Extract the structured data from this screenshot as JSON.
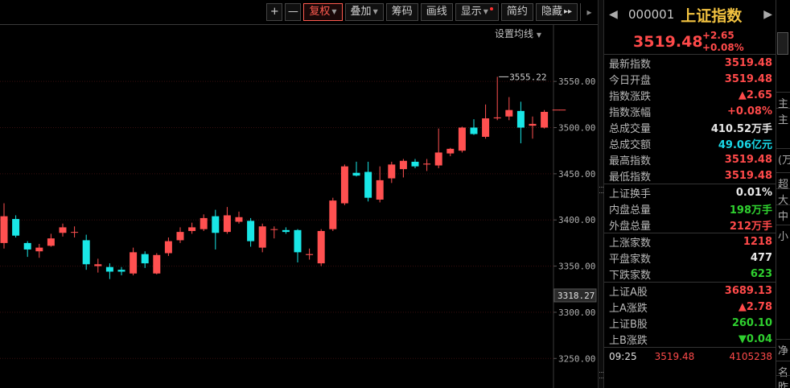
{
  "toolbar": {
    "zoom_in": "+",
    "zoom_out": "—",
    "fq_label": "复权",
    "overlay_label": "叠加",
    "chip_label": "筹码",
    "draw_label": "画线",
    "display_label": "显示",
    "simple_label": "简约",
    "hide_label": "隐藏",
    "more_label": "▸▸"
  },
  "ma_setting_label": "设置均线",
  "colors": {
    "up": "#ff5050",
    "down": "#19e6e6",
    "grid": "#3b0f0f",
    "axis_text": "#b0b0b0"
  },
  "chart_data": {
    "type": "candlestick",
    "y_ticks": [
      "3550.00",
      "3500.00",
      "3450.00",
      "3400.00",
      "3350.00",
      "3300.00",
      "3250.00"
    ],
    "ylim": [
      3218,
      3612
    ],
    "current_price_label": "3318.27",
    "high_annotation": "3555.22",
    "candles": [
      {
        "o": 3375,
        "c": 3404,
        "h": 3418,
        "l": 3369
      },
      {
        "o": 3401,
        "c": 3383,
        "h": 3405,
        "l": 3381
      },
      {
        "o": 3375,
        "c": 3368,
        "h": 3377,
        "l": 3360
      },
      {
        "o": 3366,
        "c": 3370,
        "h": 3374,
        "l": 3359
      },
      {
        "o": 3372,
        "c": 3380,
        "h": 3385,
        "l": 3371
      },
      {
        "o": 3386,
        "c": 3392,
        "h": 3396,
        "l": 3382
      },
      {
        "o": 3387,
        "c": 3387,
        "h": 3393,
        "l": 3381
      },
      {
        "o": 3378,
        "c": 3352,
        "h": 3384,
        "l": 3346
      },
      {
        "o": 3350,
        "c": 3352,
        "h": 3358,
        "l": 3343
      },
      {
        "o": 3349,
        "c": 3344,
        "h": 3353,
        "l": 3336
      },
      {
        "o": 3346,
        "c": 3344,
        "h": 3349,
        "l": 3340
      },
      {
        "o": 3342,
        "c": 3365,
        "h": 3370,
        "l": 3340
      },
      {
        "o": 3363,
        "c": 3353,
        "h": 3366,
        "l": 3348
      },
      {
        "o": 3342,
        "c": 3362,
        "h": 3364,
        "l": 3341
      },
      {
        "o": 3364,
        "c": 3377,
        "h": 3381,
        "l": 3361
      },
      {
        "o": 3378,
        "c": 3387,
        "h": 3392,
        "l": 3375
      },
      {
        "o": 3388,
        "c": 3392,
        "h": 3397,
        "l": 3385
      },
      {
        "o": 3390,
        "c": 3402,
        "h": 3406,
        "l": 3388
      },
      {
        "o": 3404,
        "c": 3386,
        "h": 3411,
        "l": 3368
      },
      {
        "o": 3387,
        "c": 3405,
        "h": 3414,
        "l": 3385
      },
      {
        "o": 3398,
        "c": 3403,
        "h": 3409,
        "l": 3396
      },
      {
        "o": 3399,
        "c": 3377,
        "h": 3402,
        "l": 3371
      },
      {
        "o": 3370,
        "c": 3393,
        "h": 3396,
        "l": 3365
      },
      {
        "o": 3390,
        "c": 3390,
        "h": 3393,
        "l": 3380
      },
      {
        "o": 3389,
        "c": 3387,
        "h": 3392,
        "l": 3385
      },
      {
        "o": 3389,
        "c": 3365,
        "h": 3390,
        "l": 3354
      },
      {
        "o": 3362,
        "c": 3363,
        "h": 3369,
        "l": 3357
      },
      {
        "o": 3353,
        "c": 3388,
        "h": 3390,
        "l": 3350
      },
      {
        "o": 3390,
        "c": 3421,
        "h": 3424,
        "l": 3388
      },
      {
        "o": 3418,
        "c": 3458,
        "h": 3460,
        "l": 3416
      },
      {
        "o": 3451,
        "c": 3448,
        "h": 3463,
        "l": 3447
      },
      {
        "o": 3452,
        "c": 3424,
        "h": 3463,
        "l": 3420
      },
      {
        "o": 3422,
        "c": 3443,
        "h": 3458,
        "l": 3419
      },
      {
        "o": 3445,
        "c": 3460,
        "h": 3463,
        "l": 3440
      },
      {
        "o": 3455,
        "c": 3464,
        "h": 3466,
        "l": 3446
      },
      {
        "o": 3463,
        "c": 3458,
        "h": 3466,
        "l": 3456
      },
      {
        "o": 3460,
        "c": 3461,
        "h": 3466,
        "l": 3453
      },
      {
        "o": 3459,
        "c": 3473,
        "h": 3499,
        "l": 3456
      },
      {
        "o": 3472,
        "c": 3477,
        "h": 3478,
        "l": 3469
      },
      {
        "o": 3475,
        "c": 3500,
        "h": 3501,
        "l": 3473
      },
      {
        "o": 3500,
        "c": 3493,
        "h": 3509,
        "l": 3492
      },
      {
        "o": 3490,
        "c": 3510,
        "h": 3525,
        "l": 3488
      },
      {
        "o": 3510,
        "c": 3511,
        "h": 3555,
        "l": 3508
      },
      {
        "o": 3512,
        "c": 3519,
        "h": 3533,
        "l": 3508
      },
      {
        "o": 3518,
        "c": 3500,
        "h": 3528,
        "l": 3483
      },
      {
        "o": 3502,
        "c": 3504,
        "h": 3512,
        "l": 3488
      },
      {
        "o": 3500,
        "c": 3517,
        "h": 3519,
        "l": 3499
      },
      {
        "o": 3519,
        "c": 3519,
        "h": 3519,
        "l": 3519
      }
    ]
  },
  "quote": {
    "code": "000001",
    "name": "上证指数",
    "price": "3519.48",
    "change": "+2.65",
    "change_pct": "+0.08%",
    "rows_group1": [
      {
        "label": "最新指数",
        "value": "3519.48",
        "color": "red"
      },
      {
        "label": "今日开盘",
        "value": "3519.48",
        "color": "red"
      },
      {
        "label": "指数涨跌",
        "value": "▲2.65",
        "color": "red"
      },
      {
        "label": "指数涨幅",
        "value": "+0.08%",
        "color": "red"
      },
      {
        "label": "总成交量",
        "value": "410.52万手",
        "color": "white"
      },
      {
        "label": "总成交额",
        "value": "49.06亿元",
        "color": "cyan"
      },
      {
        "label": "最高指数",
        "value": "3519.48",
        "color": "red"
      },
      {
        "label": "最低指数",
        "value": "3519.48",
        "color": "red"
      }
    ],
    "rows_group2": [
      {
        "label": "上证换手",
        "value": "0.01%",
        "color": "white"
      },
      {
        "label": "内盘总量",
        "value": "198万手",
        "color": "green"
      },
      {
        "label": "外盘总量",
        "value": "212万手",
        "color": "red"
      }
    ],
    "rows_group3": [
      {
        "label": "上涨家数",
        "value": "1218",
        "color": "red"
      },
      {
        "label": "平盘家数",
        "value": "477",
        "color": "white"
      },
      {
        "label": "下跌家数",
        "value": "623",
        "color": "green"
      }
    ],
    "rows_group4": [
      {
        "label": "上证A股",
        "value": "3689.13",
        "color": "red"
      },
      {
        "label": "上A涨跌",
        "value": "▲2.78",
        "color": "red"
      },
      {
        "label": "上证B股",
        "value": "260.10",
        "color": "green"
      },
      {
        "label": "上B涨跌",
        "value": "▼0.04",
        "color": "green"
      }
    ],
    "tick": {
      "time": "09:25",
      "price": "3519.48",
      "volume": "4105238"
    }
  },
  "edge_chars": [
    "主",
    "主",
    "(万",
    "超",
    "大",
    "中",
    "小",
    "净",
    "名",
    "昨"
  ]
}
